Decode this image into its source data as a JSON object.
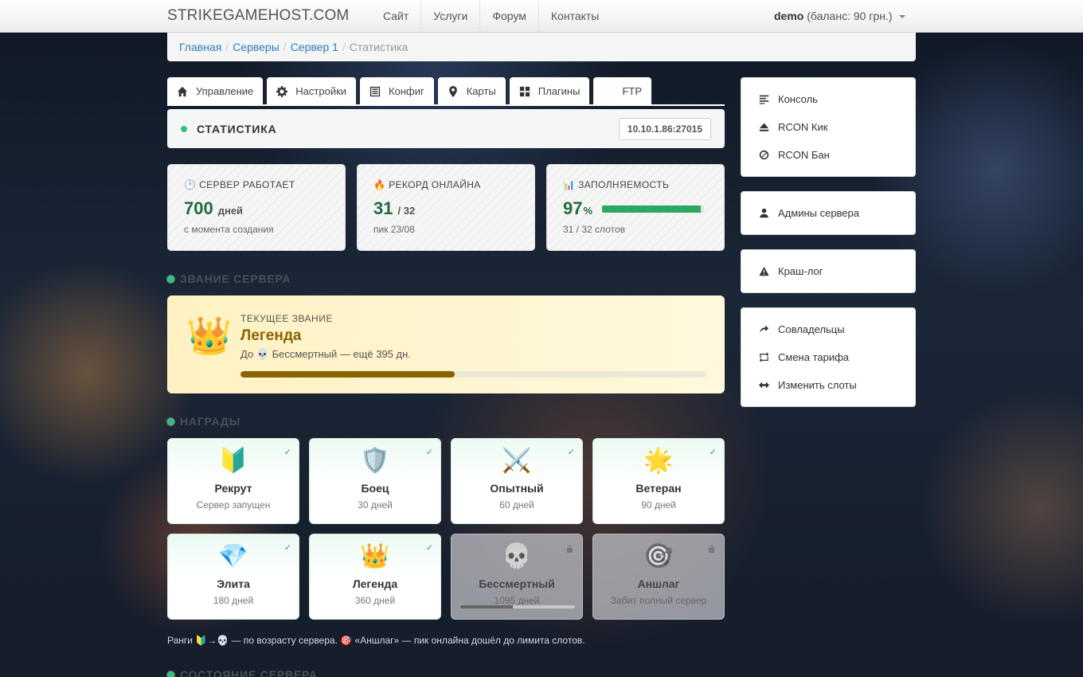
{
  "navbar": {
    "brand": "STRIKEGAMEHOST.COM",
    "links": [
      "Сайт",
      "Услуги",
      "Форум",
      "Контакты"
    ],
    "user": "demo",
    "balance": "(баланс: 90 грн.)"
  },
  "breadcrumb": [
    "Главная",
    "Серверы",
    "Сервер 1",
    "Статистика"
  ],
  "tabs": [
    "Управление",
    "Настройки",
    "Конфиг",
    "Карты",
    "Плагины",
    "FTP"
  ],
  "stat_header": {
    "title": "СТАТИСТИКА",
    "ip": "10.10.1.86:27015"
  },
  "cards": [
    {
      "icon": "🕐",
      "label": "СЕРВЕР РАБОТАЕТ",
      "value": "700",
      "unit": "дней",
      "sub": "с момента создания"
    },
    {
      "icon": "🔥",
      "label": "РЕКОРД ОНЛАЙНА",
      "value": "31",
      "unit": "/ 32",
      "sub": "пик 23/08"
    },
    {
      "icon": "📊",
      "label": "ЗАПОЛНЯЕМОСТЬ",
      "value": "97",
      "unit": "%",
      "sub": "31 / 32 слотов",
      "fill": 0.97
    }
  ],
  "sections": {
    "rank": "ЗВАНИЕ СЕРВЕРА",
    "awards": "НАГРАДЫ",
    "state": "СОСТОЯНИЕ СЕРВЕРА"
  },
  "rank": {
    "emoji": "👑",
    "caption": "ТЕКУЩЕЕ ЗВАНИЕ",
    "name": "Легенда",
    "next": "До 💀 Бессмертный — ещё 395 дн.",
    "progress": 0.46
  },
  "awards": [
    {
      "emoji": "🔰",
      "name": "Рекрут",
      "sub": "Сервер запущен",
      "earned": true
    },
    {
      "emoji": "🛡️",
      "name": "Боец",
      "sub": "30 дней",
      "earned": true
    },
    {
      "emoji": "⚔️",
      "name": "Опытный",
      "sub": "60 дней",
      "earned": true
    },
    {
      "emoji": "🌟",
      "name": "Ветеран",
      "sub": "90 дней",
      "earned": true
    },
    {
      "emoji": "💎",
      "name": "Элита",
      "sub": "180 дней",
      "earned": true
    },
    {
      "emoji": "👑",
      "name": "Легенда",
      "sub": "360 дней",
      "earned": true
    },
    {
      "emoji": "💀",
      "name": "Бессмертный",
      "sub": "1095 дней",
      "earned": false,
      "progress": 0.46
    },
    {
      "emoji": "🎯",
      "name": "Аншлаг",
      "sub": "Забит полный сервер",
      "earned": false
    }
  ],
  "check_mark": "✓",
  "note": "Ранги 🔰→💀 — по возрасту сервера. 🎯 «Аншлаг» — пик онлайна дошёл до лимита слотов.",
  "sidebar": [
    [
      {
        "icon": "console-icon",
        "label": "Консоль"
      },
      {
        "icon": "eject-icon",
        "label": "RCON Кик"
      },
      {
        "icon": "ban-icon",
        "label": "RCON Бан"
      }
    ],
    [
      {
        "icon": "user-icon",
        "label": "Админы сервера"
      }
    ],
    [
      {
        "icon": "warning-icon",
        "label": "Краш-лог"
      }
    ],
    [
      {
        "icon": "share-icon",
        "label": "Совладельцы"
      },
      {
        "icon": "retweet-icon",
        "label": "Смена тарифа"
      },
      {
        "icon": "resize-icon",
        "label": "Изменить слоты"
      }
    ]
  ]
}
